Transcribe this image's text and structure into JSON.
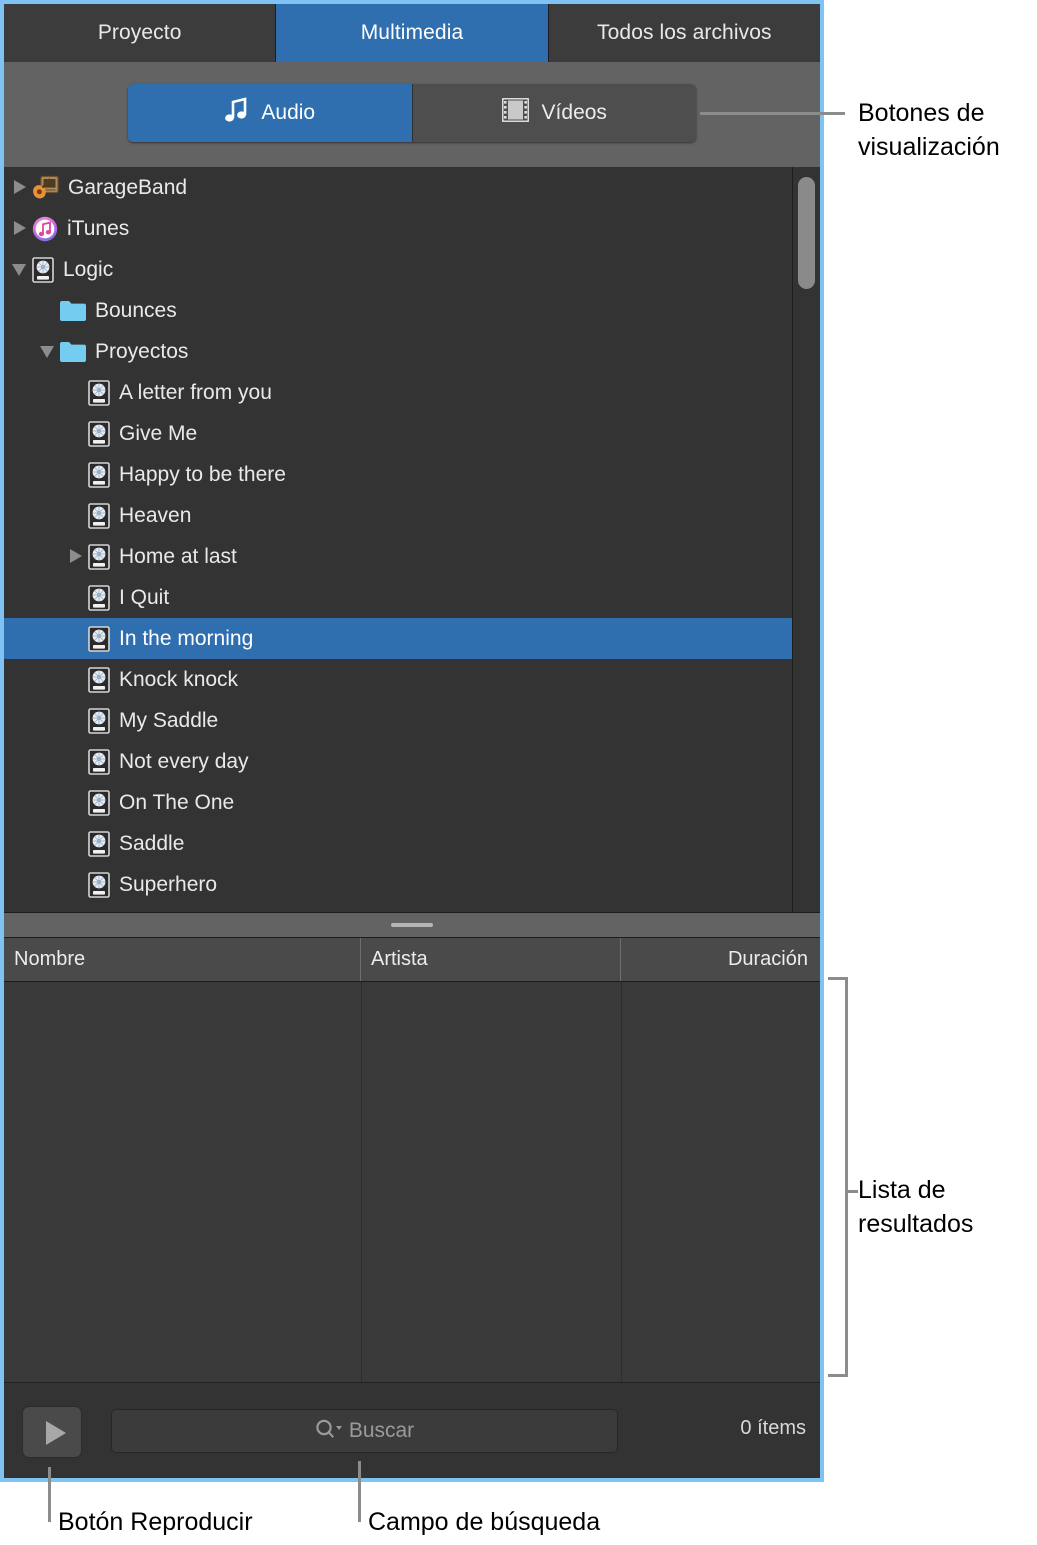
{
  "tabs": [
    {
      "label": "Proyecto",
      "active": false
    },
    {
      "label": "Multimedia",
      "active": true
    },
    {
      "label": "Todos los archivos",
      "active": false
    }
  ],
  "view_buttons": [
    {
      "label": "Audio",
      "icon": "music-note-icon",
      "active": true
    },
    {
      "label": "Vídeos",
      "icon": "film-strip-icon",
      "active": false
    }
  ],
  "tree": {
    "rows": [
      {
        "label": "GarageBand",
        "icon": "garageband-icon",
        "indent": 0,
        "disclosure": "closed",
        "selected": false
      },
      {
        "label": "iTunes",
        "icon": "itunes-icon",
        "indent": 0,
        "disclosure": "closed",
        "selected": false
      },
      {
        "label": "Logic",
        "icon": "logic-project-icon",
        "indent": 0,
        "disclosure": "open",
        "selected": false
      },
      {
        "label": "Bounces",
        "icon": "folder-icon",
        "indent": 1,
        "disclosure": "none",
        "selected": false
      },
      {
        "label": "Proyectos",
        "icon": "folder-icon",
        "indent": 1,
        "disclosure": "open",
        "selected": false
      },
      {
        "label": "A letter from you",
        "icon": "logic-project-icon",
        "indent": 2,
        "disclosure": "none",
        "selected": false
      },
      {
        "label": "Give Me",
        "icon": "logic-project-icon",
        "indent": 2,
        "disclosure": "none",
        "selected": false
      },
      {
        "label": "Happy to be there",
        "icon": "logic-project-icon",
        "indent": 2,
        "disclosure": "none",
        "selected": false
      },
      {
        "label": "Heaven",
        "icon": "logic-project-icon",
        "indent": 2,
        "disclosure": "none",
        "selected": false
      },
      {
        "label": "Home at last",
        "icon": "logic-project-icon",
        "indent": 2,
        "disclosure": "closed",
        "selected": false
      },
      {
        "label": "I Quit",
        "icon": "logic-project-icon",
        "indent": 2,
        "disclosure": "none",
        "selected": false
      },
      {
        "label": "In the morning",
        "icon": "logic-project-icon",
        "indent": 2,
        "disclosure": "none",
        "selected": true
      },
      {
        "label": "Knock knock",
        "icon": "logic-project-icon",
        "indent": 2,
        "disclosure": "none",
        "selected": false
      },
      {
        "label": "My Saddle",
        "icon": "logic-project-icon",
        "indent": 2,
        "disclosure": "none",
        "selected": false
      },
      {
        "label": "Not every day",
        "icon": "logic-project-icon",
        "indent": 2,
        "disclosure": "none",
        "selected": false
      },
      {
        "label": "On The One",
        "icon": "logic-project-icon",
        "indent": 2,
        "disclosure": "none",
        "selected": false
      },
      {
        "label": "Saddle",
        "icon": "logic-project-icon",
        "indent": 2,
        "disclosure": "none",
        "selected": false
      },
      {
        "label": "Superhero",
        "icon": "logic-project-icon",
        "indent": 2,
        "disclosure": "none",
        "selected": false
      },
      {
        "label": "",
        "icon": "logic-project-icon",
        "indent": 2,
        "disclosure": "none",
        "selected": false
      }
    ]
  },
  "results_table": {
    "columns": [
      "Nombre",
      "Artista",
      "Duración"
    ],
    "rows": []
  },
  "bottom_bar": {
    "play_icon": "play-icon",
    "search_icon": "search-icon",
    "search_placeholder": "Buscar",
    "search_value": "",
    "items_count": "0 ítems"
  },
  "callouts": [
    {
      "id": "view-buttons",
      "text": "Botones de\nvisualización"
    },
    {
      "id": "results-list",
      "text": "Lista de\nresultados"
    },
    {
      "id": "play-button",
      "text": "Botón Reproducir"
    },
    {
      "id": "search-field",
      "text": "Campo de búsqueda"
    }
  ],
  "colors": {
    "accent_blue": "#2f6fb0",
    "panel_border": "#7fc3f5",
    "folder_blue": "#74cdf0",
    "callout_gray": "#8c8c8c"
  }
}
